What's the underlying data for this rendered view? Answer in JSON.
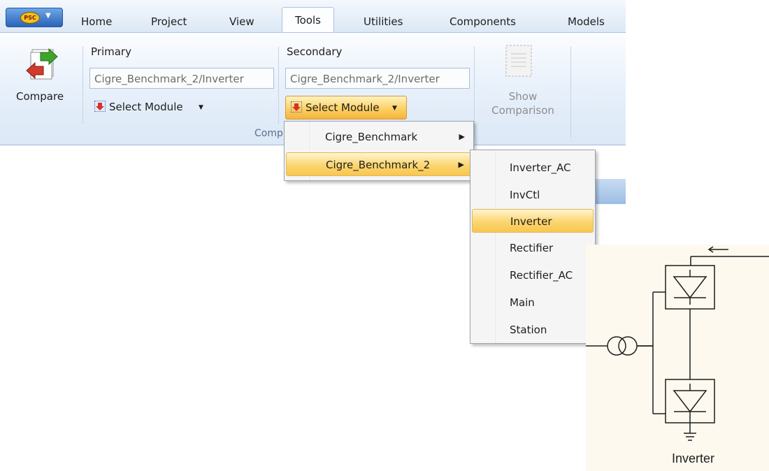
{
  "app_menu": {
    "logo_text": "PSC"
  },
  "tabs": [
    "Home",
    "Project",
    "View",
    "Tools",
    "Utilities",
    "Components",
    "Models"
  ],
  "active_tab": "Tools",
  "ribbon": {
    "compare_label": "Compare",
    "primary": {
      "label": "Primary",
      "value": "Cigre_Benchmark_2/Inverter",
      "select_label": "Select Module"
    },
    "secondary": {
      "label": "Secondary",
      "value": "Cigre_Benchmark_2/Inverter",
      "select_label": "Select Module"
    },
    "show_comparison_label_line1": "Show",
    "show_comparison_label_line2": "Comparison",
    "group_label": "Comp"
  },
  "menu_projects": [
    {
      "label": "Cigre_Benchmark",
      "has_submenu": true,
      "highlighted": false
    },
    {
      "label": "Cigre_Benchmark_2",
      "has_submenu": true,
      "highlighted": true
    }
  ],
  "menu_modules": [
    {
      "label": "Inverter_AC",
      "highlighted": false
    },
    {
      "label": "InvCtl",
      "highlighted": false
    },
    {
      "label": "Inverter",
      "highlighted": true
    },
    {
      "label": "Rectifier",
      "highlighted": false
    },
    {
      "label": "Rectifier_AC",
      "highlighted": false
    },
    {
      "label": "Main",
      "highlighted": false
    },
    {
      "label": "Station",
      "highlighted": false
    }
  ],
  "diagram": {
    "label": "Inverter"
  },
  "colors": {
    "highlight": "#fbd56f",
    "ribbon_bg": "#dbe8f6",
    "menu_bg": "#f5f5f5",
    "diagram_bg": "#fdf9ef"
  }
}
